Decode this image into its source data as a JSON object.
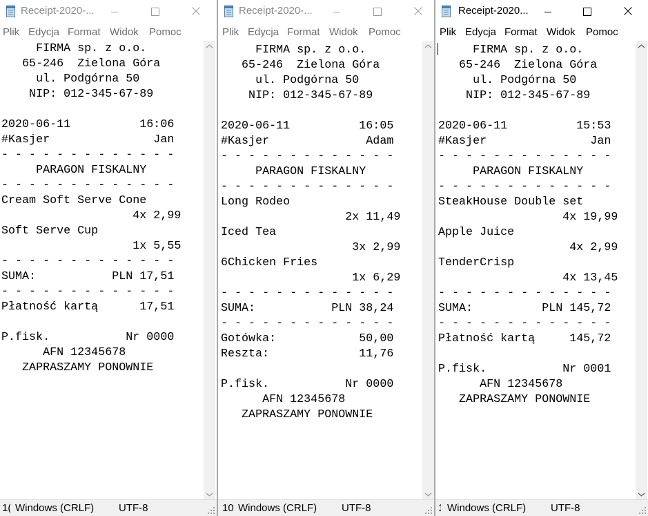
{
  "menu_labels": [
    "Plik",
    "Edycja",
    "Format",
    "Widok",
    "Pomoc"
  ],
  "status": {
    "line_ending": "Windows (CRLF)",
    "encoding": "UTF-8"
  },
  "windows": [
    {
      "title": "Receipt-2020-...",
      "status_position": "1(",
      "lines": [
        "     FIRMA sp. z o.o.",
        "   65-246  Zielona Góra",
        "     ul. Podgórna 50",
        "    NIP: 012-345-67-89",
        "",
        "2020-06-11          16:06",
        "#Kasjer               Jan",
        "- - - - - - - - - - - - -",
        "     PARAGON FISKALNY",
        "- - - - - - - - - - - - -",
        "Cream Soft Serve Cone",
        "                   4x 2,99",
        "Soft Serve Cup",
        "                   1x 5,55",
        "- - - - - - - - - - - - -",
        "SUMA:           PLN 17,51",
        "- - - - - - - - - - - - -",
        "Płatność kartą      17,51",
        "",
        "P.fisk.           Nr 0000",
        "      AFN 12345678",
        "   ZAPRASZAMY PONOWNIE"
      ]
    },
    {
      "title": "Receipt-2020-...",
      "status_position": "10",
      "lines": [
        "     FIRMA sp. z o.o.",
        "   65-246  Zielona Góra",
        "     ul. Podgórna 50",
        "    NIP: 012-345-67-89",
        "",
        "2020-06-11          16:05",
        "#Kasjer              Adam",
        "- - - - - - - - - - - - -",
        "     PARAGON FISKALNY",
        "- - - - - - - - - - - - -",
        "Long Rodeo",
        "                  2x 11,49",
        "Iced Tea",
        "                   3x 2,99",
        "6Chicken Fries",
        "                   1x 6,29",
        "- - - - - - - - - - - - -",
        "SUMA:           PLN 38,24",
        "- - - - - - - - - - - - -",
        "Gotówka:            50,00",
        "Reszta:             11,76",
        "",
        "P.fisk.           Nr 0000",
        "      AFN 12345678",
        "   ZAPRASZAMY PONOWNIE"
      ]
    },
    {
      "title": "Receipt-2020...",
      "status_position": "1",
      "lines": [
        "     FIRMA sp. z o.o.",
        "   65-246  Zielona Góra",
        "     ul. Podgórna 50",
        "    NIP: 012-345-67-89",
        "",
        "2020-06-11          15:53",
        "#Kasjer               Jan",
        "- - - - - - - - - - - - -",
        "     PARAGON FISKALNY",
        "- - - - - - - - - - - - -",
        "SteakHouse Double set",
        "                  4x 19,99",
        "Apple Juice",
        "                   4x 2,99",
        "TenderCrisp",
        "                  4x 13,45",
        "- - - - - - - - - - - - -",
        "SUMA:          PLN 145,72",
        "- - - - - - - - - - - - -",
        "Płatność kartą     145,72",
        "",
        "P.fisk.           Nr 0001",
        "      AFN 12345678",
        "   ZAPRASZAMY PONOWNIE"
      ]
    }
  ]
}
